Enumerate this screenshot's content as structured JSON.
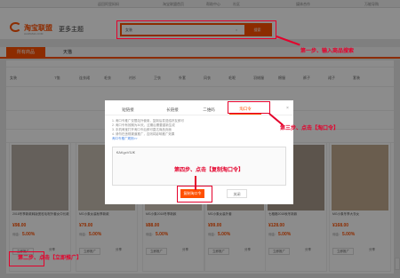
{
  "topbar": {
    "links": [
      "",
      "返回阿里妈妈",
      "淘宝联盟首页",
      "帮助中心",
      "社区",
      "媒体合作",
      "万能导购"
    ]
  },
  "header": {
    "logo_text": "淘宝联盟",
    "logo_sub": "ALIMAMA.COM",
    "theme": "更多主题",
    "search_value": "女装",
    "search_button": "搜索"
  },
  "nav": {
    "tabs": [
      "所有商品",
      "天猫"
    ]
  },
  "filters": {
    "categories": [
      "女装",
      "T恤",
      "连衣裙",
      "毛衣",
      "衬衫",
      "卫衣",
      "外套",
      "风衣",
      "毛呢",
      "羽绒服",
      "棉服",
      "裤子",
      "裙子",
      "套装"
    ]
  },
  "products": [
    {
      "title": "2018冬季新款韩版宽松毛呢外套女中长款",
      "price": "¥98.00",
      "rate_label": "佣金：",
      "rate": "5.00%",
      "promote": "立即推广",
      "share": "分享"
    },
    {
      "title": "MG小象女装秋季新款",
      "price": "¥79.00",
      "rate_label": "佣金：",
      "rate": "5.00%",
      "promote": "立即推广",
      "share": "分享"
    },
    {
      "title": "MG小象2018冬季新款",
      "price": "¥88.00",
      "rate_label": "佣金：",
      "rate": "5.00%",
      "promote": "立即推广",
      "share": "分享"
    },
    {
      "title": "MG小象女装外套",
      "price": "¥99.00",
      "rate_label": "佣金：",
      "rate": "5.00%",
      "promote": "立即推广",
      "share": "分享"
    },
    {
      "title": "七格格2018秋冬新款",
      "price": "¥128.00",
      "rate_label": "佣金：",
      "rate": "5.00%",
      "promote": "立即推广",
      "share": "分享"
    },
    {
      "title": "MG小象冬季大衣女",
      "price": "¥168.00",
      "rate_label": "佣金：",
      "rate": "5.00%",
      "promote": "立即推广",
      "share": "分享"
    }
  ],
  "modal": {
    "tabs": [
      "短链接",
      "长链接",
      "二维码",
      "淘口令"
    ],
    "active_tab": "淘口令",
    "tips": [
      "1. 淘口令推广仅限站外使用，复制后发送给好友即可",
      "2. 淘口令有效期为30天，过期后需要重新生成",
      "3. 手机淘宝打开淘口令后即可直达商品页面",
      "4. 请勿在违规渠道推广，否则将影响推广效果"
    ],
    "tips_link": "淘口令推广规则>>",
    "code": "€AKgxV5J€",
    "copy_button": "复制淘口令",
    "close_button": "关闭",
    "close_icon": "×"
  },
  "annotations": {
    "step1": "第一步、输入商品搜索",
    "step2": "第二步、点击【立即推广】",
    "step3": "第三步、点击【淘口令】",
    "step4": "第四步、点击【复制淘口令】"
  },
  "colors": {
    "brand": "#ff5000",
    "annotation": "#e4002b"
  }
}
